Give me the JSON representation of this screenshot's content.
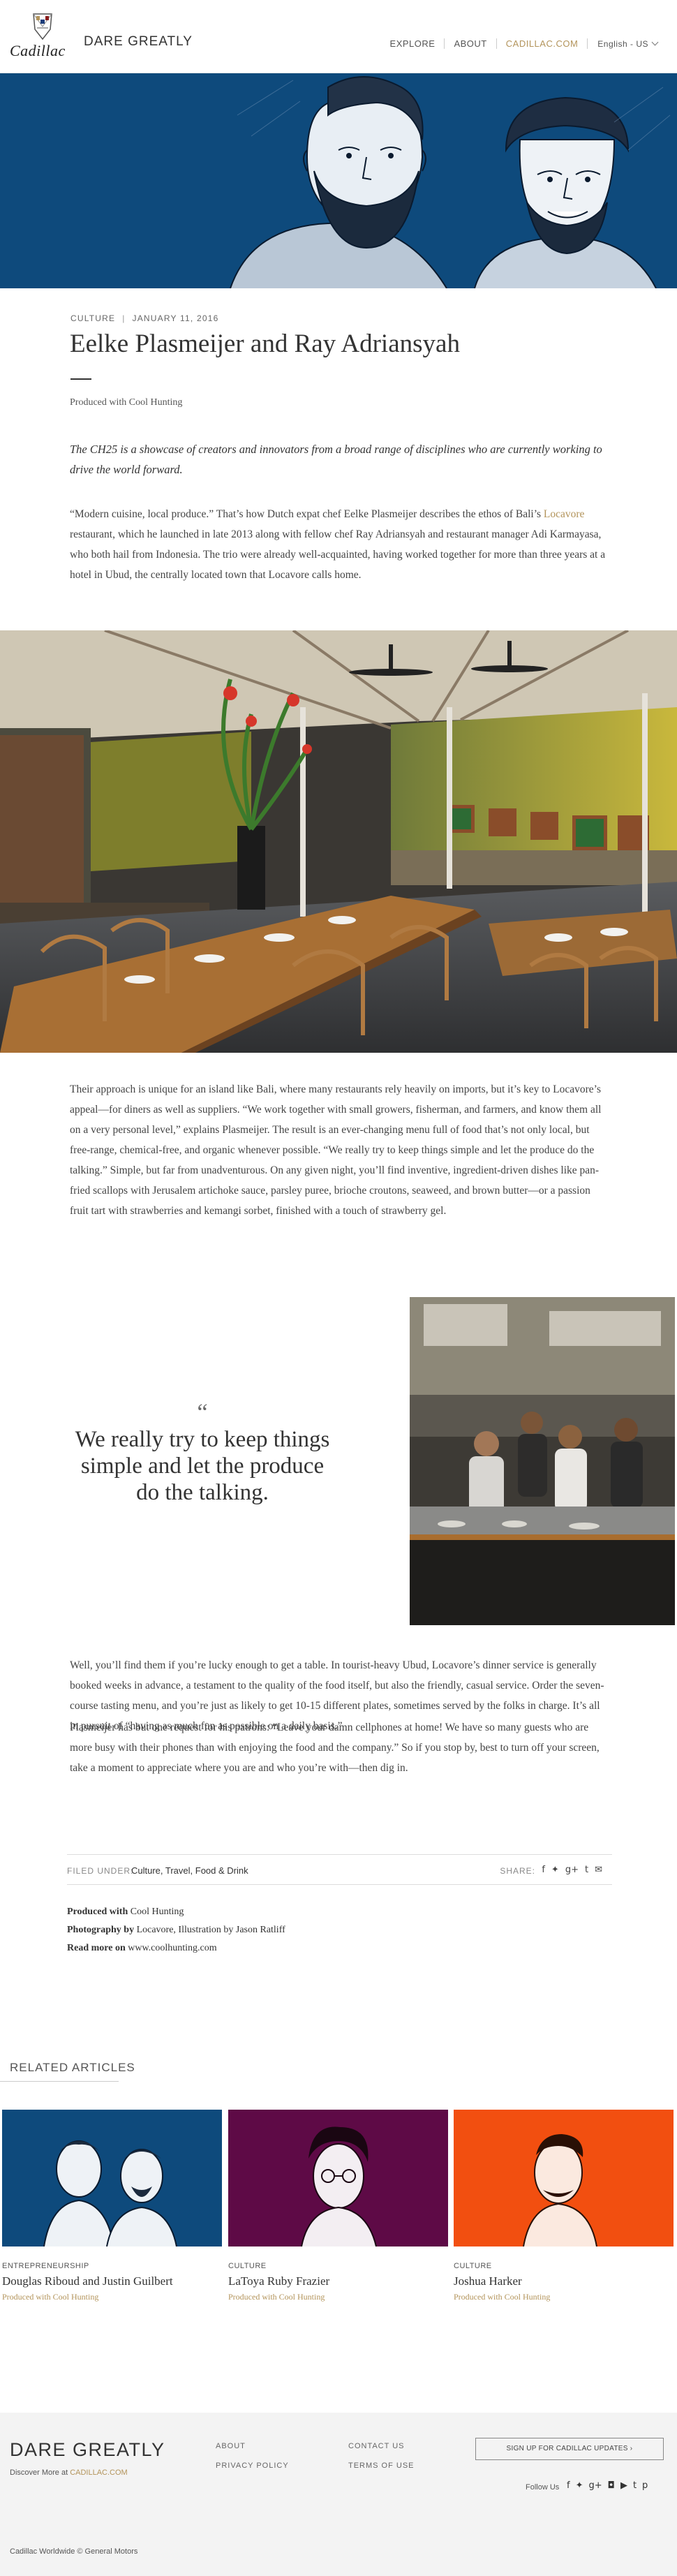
{
  "header": {
    "logo_text": "Cadillac",
    "site_title": "DARE GREATLY",
    "nav": {
      "explore": "EXPLORE",
      "about": "ABOUT",
      "cadillac": "CADILLAC.COM",
      "language": "English - US"
    }
  },
  "article": {
    "category": "CULTURE",
    "date": "JANUARY 11, 2016",
    "title": "Eelke Plasmeijer and Ray Adriansyah",
    "produced_by": "Produced with Cool Hunting",
    "intro": "The CH25 is a showcase of creators and innovators from a broad range of disciplines who are currently working to drive the world forward.",
    "p1_a": "“Modern cuisine, local produce.” That’s how Dutch expat chef Eelke Plasmeijer describes the ethos of Bali’s ",
    "p1_link": "Locavore",
    "p1_b": " restaurant, which he launched in late 2013 along with fellow chef Ray Adriansyah and restaurant manager Adi Karmayasa, who both hail from Indonesia. The trio were already well-acquainted, having worked together for more than three years at a hotel in Ubud, the centrally located town that Locavore calls home.",
    "p2": "Their approach is unique for an island like Bali, where many restaurants rely heavily on imports, but it’s key to Locavore’s appeal—for diners as well as suppliers. “We work together with small growers, fisherman, and farmers, and know them all on a very personal level,” explains Plasmeijer. The result is an ever-changing menu full of food that’s not only local, but free-range, chemical-free, and organic whenever possible. “We really try to keep things simple and let the produce do the talking.” Simple, but far from unadventurous. On any given night, you’ll find inventive, ingredient-driven dishes like pan-fried scallops with Jerusalem artichoke sauce, parsley puree, brioche croutons, seaweed, and brown butter—or a passion fruit tart with strawberries and kemangi sorbet, finished with a touch of strawberry gel.",
    "quote_mark": "“",
    "quote": "We really try to keep things simple and let the produce do the talking.",
    "p3": "Well, you’ll find them if you’re lucky enough to get a table. In tourist-heavy Ubud, Locavore’s dinner service is generally booked weeks in advance, a testament to the quality of the food itself, but also the friendly, casual service. Order the seven-course tasting menu, and you’re just as likely to get 10-15 different plates, sometimes served by the folks in charge. It’s all in pursuit of “having as much fun as possible on a daily basis.”",
    "p4": "Plasmeijer has but one request for his patrons: “Leave your damn cellphones at home! We have so many guests who are more busy with their phones than with enjoying the food and the company.” So if you stop by, best to turn off your screen, take a moment to appreciate where you are and who you’re with—then dig in.",
    "filed_label": "FILED UNDER:",
    "filed_tags": "Culture, Travel, Food & Drink",
    "share_label": "SHARE:",
    "share_icons": [
      "facebook-icon",
      "twitter-icon",
      "google-plus-icon",
      "tumblr-icon",
      "email-icon"
    ],
    "credits": {
      "produced_label": "Produced with",
      "produced_value": "Cool Hunting",
      "photo_label": "Photography by",
      "photo_value": "Locavore, Illustration by Jason Ratliff",
      "read_label": "Read more on",
      "read_value": "www.coolhunting.com"
    }
  },
  "related": {
    "heading": "RELATED ARTICLES",
    "items": [
      {
        "category": "ENTREPRENEURSHIP",
        "name": "Douglas Riboud and Justin Guilbert",
        "produced": "Produced with Cool Hunting",
        "color": "#0e4a7c"
      },
      {
        "category": "CULTURE",
        "name": "LaToya Ruby Frazier",
        "produced": "Produced with Cool Hunting",
        "color": "#5e0a46"
      },
      {
        "category": "CULTURE",
        "name": "Joshua Harker",
        "produced": "Produced with Cool Hunting",
        "color": "#f24f10"
      }
    ]
  },
  "footer": {
    "brand": "DARE GREATLY",
    "discover_prefix": "Discover More at",
    "discover_link": "CADILLAC.COM",
    "about": "ABOUT",
    "privacy": "PRIVACY POLICY",
    "contact": "CONTACT US",
    "terms": "TERMS OF USE",
    "signup": "SIGN UP FOR CADILLAC UPDATES  ›",
    "follow": "Follow Us",
    "copyright": "Cadillac Worldwide © General Motors"
  },
  "colors": {
    "accent_gold": "#b3945b",
    "hero_blue": "#0e4a7c"
  }
}
